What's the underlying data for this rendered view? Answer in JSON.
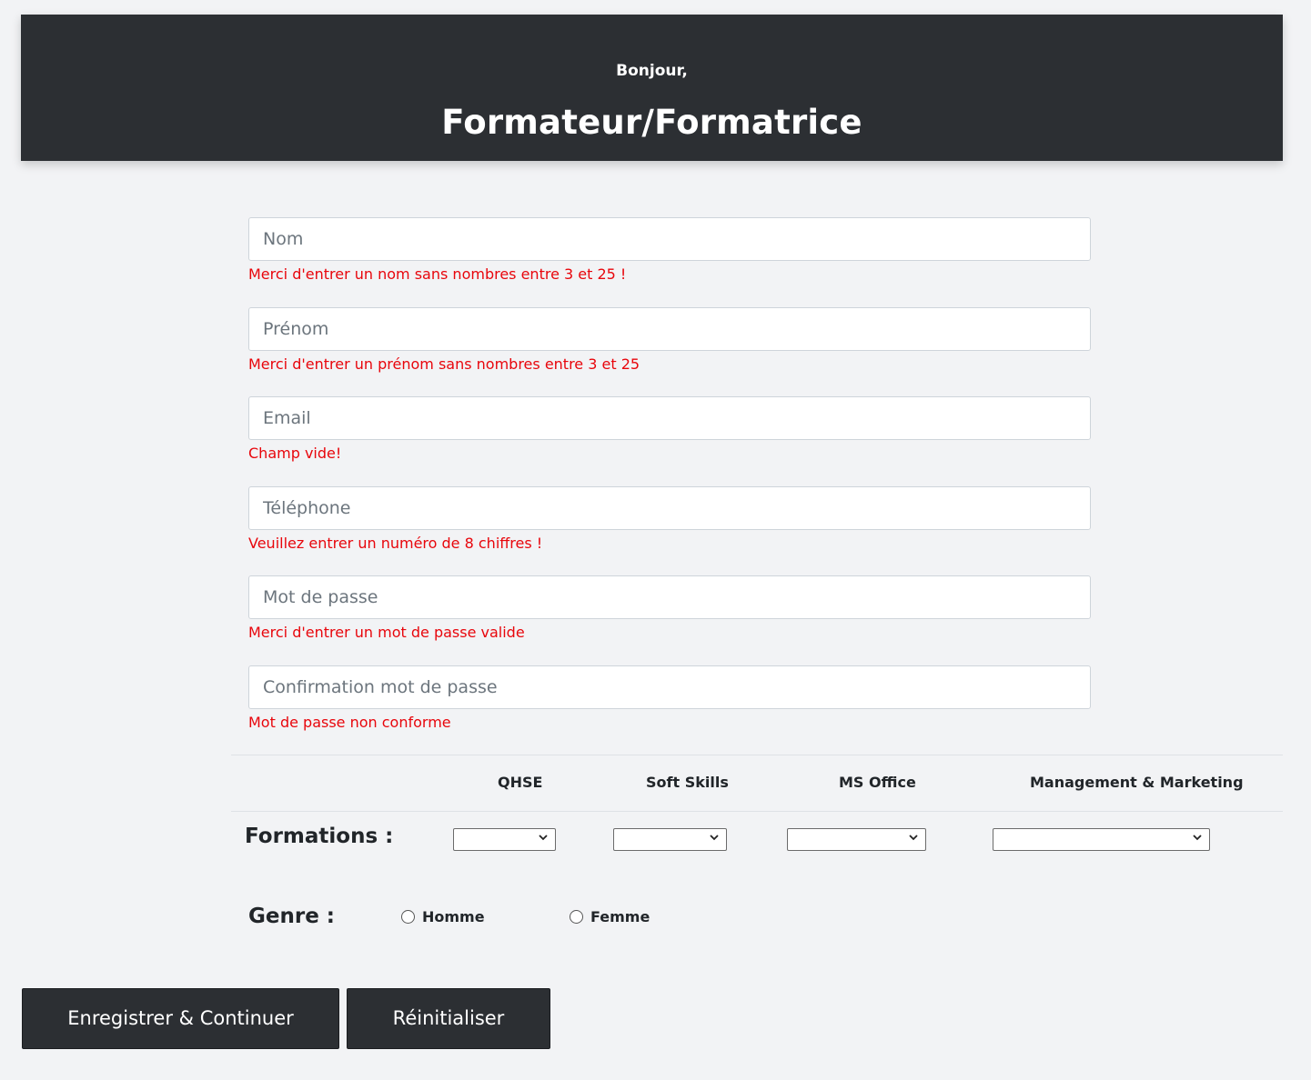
{
  "header": {
    "greeting": "Bonjour,",
    "title": "Formateur/Formatrice"
  },
  "form": {
    "fields": [
      {
        "placeholder": "Nom",
        "value": "",
        "error": "Merci d'entrer un nom sans nombres entre 3 et 25 !"
      },
      {
        "placeholder": "Prénom",
        "value": "",
        "error": "Merci d'entrer un prénom sans nombres entre 3 et 25"
      },
      {
        "placeholder": "Email",
        "value": "",
        "error": "Champ vide!"
      },
      {
        "placeholder": "Téléphone",
        "value": "",
        "error": "Veuillez entrer un numéro de 8 chiffres !"
      },
      {
        "placeholder": "Mot de passe",
        "value": "",
        "error": "Merci d'entrer un mot de passe valide"
      },
      {
        "placeholder": "Confirmation mot de passe",
        "value": "",
        "error": "Mot de passe non conforme"
      }
    ]
  },
  "formations": {
    "label": "Formations :",
    "columns": [
      "QHSE",
      "Soft Skills",
      "MS Office",
      "Management & Marketing"
    ],
    "selected": [
      "",
      "",
      "",
      ""
    ]
  },
  "genre": {
    "label": "Genre :",
    "options": [
      "Homme",
      "Femme"
    ]
  },
  "buttons": {
    "save": "Enregistrer & Continuer",
    "reset": "Réinitialiser"
  },
  "colors": {
    "header_bg": "#2c2f33",
    "error": "#e8060c",
    "page_bg": "#f2f3f5"
  }
}
